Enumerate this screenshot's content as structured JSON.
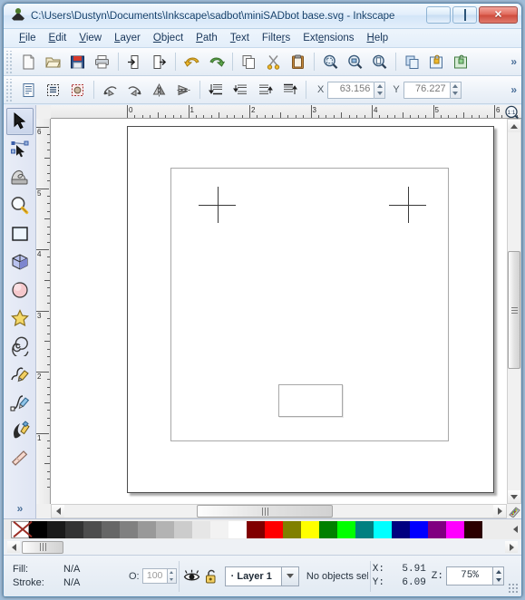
{
  "window": {
    "title": "C:\\Users\\Dustyn\\Documents\\Inkscape\\sadbot\\miniSADbot base.svg - Inkscape",
    "app_icon": "inkscape-logo-icon",
    "controls": {
      "minimize": "minimize-button",
      "maximize": "maximize-button",
      "close": "close-button"
    }
  },
  "menubar": {
    "items": [
      {
        "label": "File"
      },
      {
        "label": "Edit"
      },
      {
        "label": "View"
      },
      {
        "label": "Layer"
      },
      {
        "label": "Object"
      },
      {
        "label": "Path"
      },
      {
        "label": "Text"
      },
      {
        "label": "Filters"
      },
      {
        "label": "Extensions"
      },
      {
        "label": "Help"
      }
    ]
  },
  "commands_toolbar": {
    "overflow_label": "»",
    "buttons": [
      {
        "name": "new-document-icon",
        "title": "New"
      },
      {
        "name": "open-document-icon",
        "title": "Open"
      },
      {
        "name": "save-document-icon",
        "title": "Save"
      },
      {
        "name": "print-document-icon",
        "title": "Print"
      },
      {
        "name": "import-icon",
        "title": "Import"
      },
      {
        "name": "export-icon",
        "title": "Export"
      },
      {
        "name": "undo-icon",
        "title": "Undo"
      },
      {
        "name": "redo-icon",
        "title": "Redo"
      },
      {
        "name": "copy-icon",
        "title": "Copy"
      },
      {
        "name": "cut-icon",
        "title": "Cut"
      },
      {
        "name": "paste-icon",
        "title": "Paste"
      },
      {
        "name": "zoom-selection-icon",
        "title": "Zoom selection"
      },
      {
        "name": "zoom-drawing-icon",
        "title": "Zoom drawing"
      },
      {
        "name": "zoom-page-icon",
        "title": "Zoom page"
      },
      {
        "name": "duplicate-icon",
        "title": "Duplicate"
      },
      {
        "name": "group-icon",
        "title": "Group"
      },
      {
        "name": "ungroup-icon",
        "title": "Ungroup"
      }
    ]
  },
  "tool_options_toolbar": {
    "overflow_label": "»",
    "buttons": [
      {
        "name": "document-properties-icon",
        "title": "Document properties"
      },
      {
        "name": "xml-editor-icon",
        "title": "XML editor"
      },
      {
        "name": "preferences-icon",
        "title": "Preferences"
      },
      {
        "name": "rotate-ccw-icon",
        "title": "Rotate 90 CCW"
      },
      {
        "name": "rotate-cw-icon",
        "title": "Rotate 90 CW"
      },
      {
        "name": "flip-horizontal-icon",
        "title": "Flip horizontal"
      },
      {
        "name": "flip-vertical-icon",
        "title": "Flip vertical"
      },
      {
        "name": "lower-to-bottom-icon",
        "title": "Lower to bottom"
      },
      {
        "name": "lower-icon",
        "title": "Lower"
      },
      {
        "name": "raise-icon",
        "title": "Raise"
      },
      {
        "name": "raise-to-top-icon",
        "title": "Raise to top"
      }
    ],
    "x_label": "X",
    "x_value": "63.156",
    "y_label": "Y",
    "y_value": "76.227"
  },
  "toolbox": {
    "overflow_label": "»",
    "active_index": 0,
    "tools": [
      {
        "name": "selector-tool",
        "label": "Selector"
      },
      {
        "name": "node-tool",
        "label": "Node editor"
      },
      {
        "name": "tweak-tool",
        "label": "Tweak"
      },
      {
        "name": "zoom-tool",
        "label": "Zoom"
      },
      {
        "name": "rectangle-tool",
        "label": "Rectangle"
      },
      {
        "name": "3dbox-tool",
        "label": "3D Box"
      },
      {
        "name": "ellipse-tool",
        "label": "Ellipse"
      },
      {
        "name": "star-tool",
        "label": "Star"
      },
      {
        "name": "spiral-tool",
        "label": "Spiral"
      },
      {
        "name": "pencil-tool",
        "label": "Pencil"
      },
      {
        "name": "bezier-tool",
        "label": "Bezier"
      },
      {
        "name": "calligraphy-tool",
        "label": "Calligraphy"
      },
      {
        "name": "eraser-tool",
        "label": "Eraser"
      }
    ]
  },
  "rulers": {
    "unit": "in",
    "horizontal_labels": [
      "0",
      "1",
      "2",
      "3",
      "4",
      "5",
      "6"
    ],
    "vertical_labels": [
      "6",
      "5",
      "4",
      "3",
      "2",
      "1"
    ],
    "corner_icon": "zoom-1-to-1-icon"
  },
  "canvas": {
    "page_label": "document-page",
    "objects": [
      {
        "name": "inner-frame-rect",
        "type": "rect"
      },
      {
        "name": "crosshair-mark-left",
        "type": "cross"
      },
      {
        "name": "crosshair-mark-right",
        "type": "cross"
      },
      {
        "name": "bottom-rect",
        "type": "rect"
      }
    ]
  },
  "palette": {
    "none_swatch": "none",
    "colors": [
      "#000000",
      "#1a1a1a",
      "#333333",
      "#4d4d4d",
      "#666666",
      "#808080",
      "#999999",
      "#b3b3b3",
      "#cccccc",
      "#e6e6e6",
      "#f2f2f2",
      "#ffffff",
      "#800000",
      "#ff0000",
      "#808000",
      "#ffff00",
      "#008000",
      "#00ff00",
      "#008080",
      "#00ffff",
      "#000080",
      "#0000ff",
      "#800080",
      "#ff00ff",
      "#2b0000"
    ],
    "scroll_arrow": "palette-scroll-arrow-icon"
  },
  "statusbar": {
    "fill_label": "Fill:",
    "stroke_label": "Stroke:",
    "fill_value": "N/A",
    "stroke_value": "N/A",
    "opacity_label": "O:",
    "opacity_value": "100",
    "visibility_icon": "eye-icon",
    "lock_icon": "unlocked-padlock-icon",
    "layer_name": "· Layer 1",
    "layer_dropdown_icon": "chevron-down-icon",
    "status_message": "No objects sele.",
    "x_label": "X:",
    "y_label": "Y:",
    "x_value": "5.91",
    "y_value": "6.09",
    "zoom_label": "Z:",
    "zoom_value": "75%"
  }
}
